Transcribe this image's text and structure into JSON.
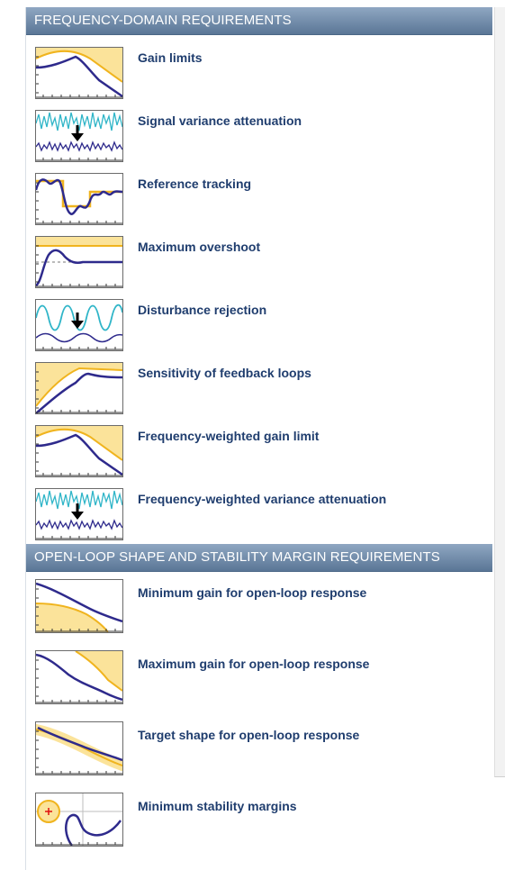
{
  "sections": [
    {
      "title": "FREQUENCY-DOMAIN REQUIREMENTS",
      "items": [
        {
          "label": "Gain limits",
          "icon": "gain-limits-icon"
        },
        {
          "label": "Signal variance attenuation",
          "icon": "signal-variance-icon"
        },
        {
          "label": "Reference tracking",
          "icon": "reference-tracking-icon"
        },
        {
          "label": "Maximum overshoot",
          "icon": "maximum-overshoot-icon"
        },
        {
          "label": "Disturbance rejection",
          "icon": "disturbance-rejection-icon"
        },
        {
          "label": "Sensitivity of feedback loops",
          "icon": "sensitivity-icon"
        },
        {
          "label": "Frequency-weighted gain limit",
          "icon": "weighted-gain-icon"
        },
        {
          "label": "Frequency-weighted variance attenuation",
          "icon": "weighted-variance-icon"
        }
      ]
    },
    {
      "title": "OPEN-LOOP SHAPE AND STABILITY MARGIN REQUIREMENTS",
      "items": [
        {
          "label": "Minimum gain for open-loop response",
          "icon": "min-gain-icon"
        },
        {
          "label": "Maximum gain for open-loop response",
          "icon": "max-gain-icon"
        },
        {
          "label": "Target shape for open-loop response",
          "icon": "target-shape-icon"
        },
        {
          "label": "Minimum stability margins",
          "icon": "stability-margins-icon"
        }
      ]
    }
  ],
  "colors": {
    "header_bg": "#6a86a8",
    "label_text": "#1f3d6e",
    "curve": "#2e2a8c",
    "limit_fill": "#fbe39a",
    "limit_line": "#f0b41e",
    "signal_cyan": "#2fb5c8"
  }
}
